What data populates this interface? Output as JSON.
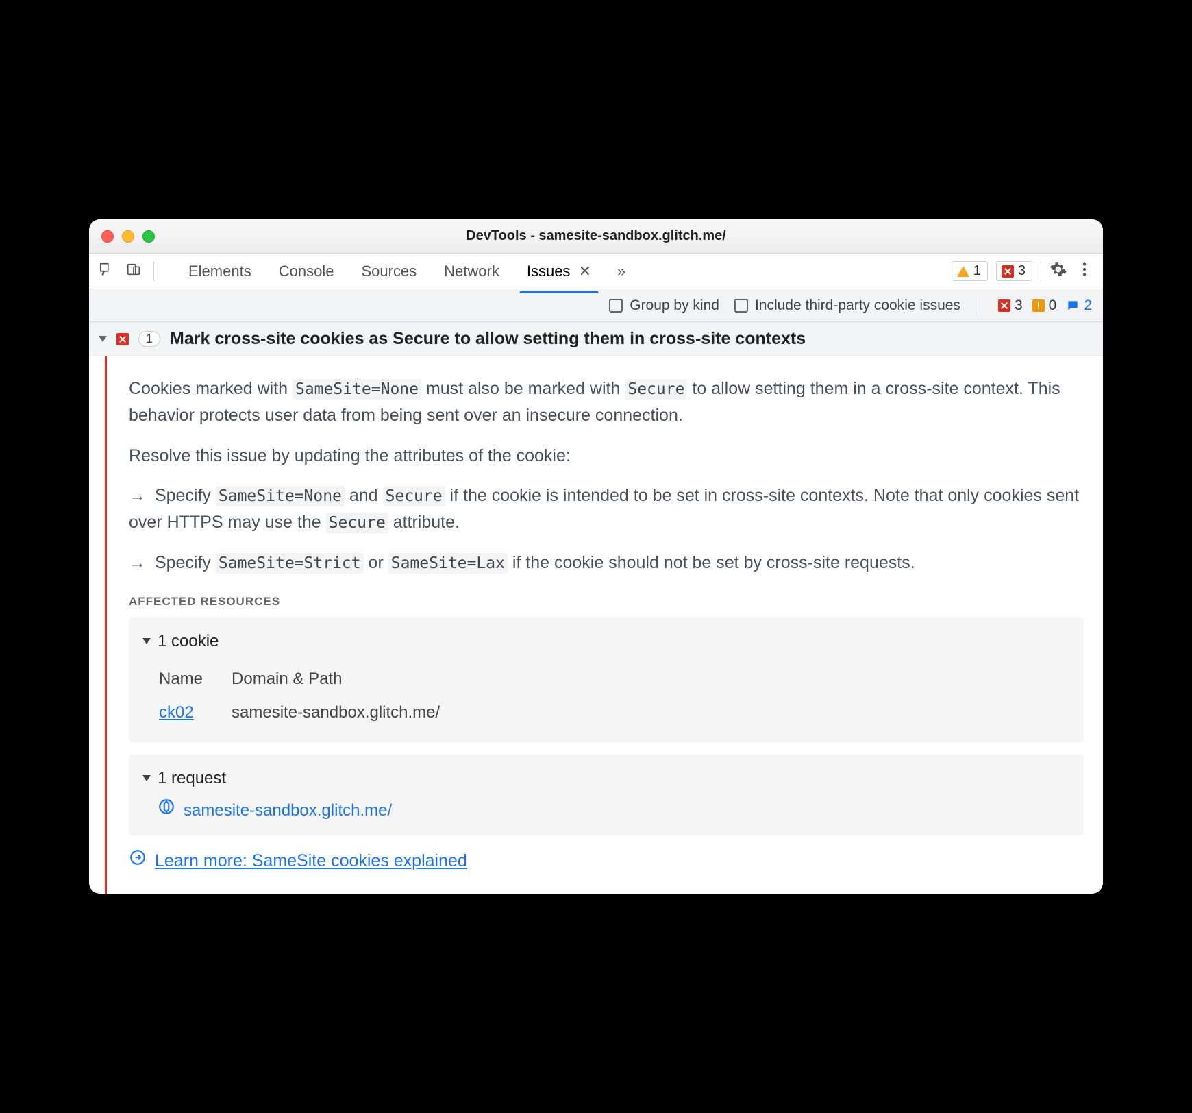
{
  "window": {
    "title": "DevTools - samesite-sandbox.glitch.me/"
  },
  "tabs": {
    "elements": "Elements",
    "console": "Console",
    "sources": "Sources",
    "network": "Network",
    "issues": "Issues"
  },
  "toolbar_badges": {
    "warnings": "1",
    "errors": "3"
  },
  "filter": {
    "group_by_kind": "Group by kind",
    "third_party": "Include third-party cookie issues",
    "counts": {
      "errors": "3",
      "warnings": "0",
      "info": "2"
    }
  },
  "issue": {
    "count": "1",
    "title": "Mark cross-site cookies as Secure to allow setting them in cross-site contexts",
    "p1_a": "Cookies marked with ",
    "p1_code1": "SameSite=None",
    "p1_b": " must also be marked with ",
    "p1_code2": "Secure",
    "p1_c": " to allow setting them in a cross-site context. This behavior protects user data from being sent over an insecure connection.",
    "p2": "Resolve this issue by updating the attributes of the cookie:",
    "b1_a": "Specify ",
    "b1_code1": "SameSite=None",
    "b1_b": " and ",
    "b1_code2": "Secure",
    "b1_c": " if the cookie is intended to be set in cross-site contexts. Note that only cookies sent over HTTPS may use the ",
    "b1_code3": "Secure",
    "b1_d": " attribute.",
    "b2_a": "Specify ",
    "b2_code1": "SameSite=Strict",
    "b2_b": " or ",
    "b2_code2": "SameSite=Lax",
    "b2_c": " if the cookie should not be set by cross-site requests.",
    "affected_label": "AFFECTED RESOURCES",
    "cookies_header": "1 cookie",
    "th_name": "Name",
    "th_domain": "Domain & Path",
    "cookie_name": "ck02",
    "cookie_domain": "samesite-sandbox.glitch.me/",
    "requests_header": "1 request",
    "request_url": "samesite-sandbox.glitch.me/",
    "learn_more": "Learn more: SameSite cookies explained"
  }
}
